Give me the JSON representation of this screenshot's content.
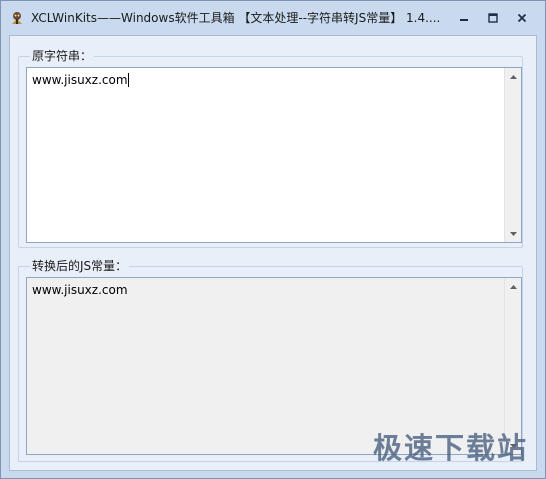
{
  "window": {
    "title": "XCLWinKits——Windows软件工具箱 【文本处理--字符串转JS常量】 1.4...."
  },
  "input_group": {
    "label": "原字符串：",
    "value": "www.jisuxz.com"
  },
  "output_group": {
    "label": "转换后的JS常量：",
    "value": "www.jisuxz.com"
  },
  "watermark": {
    "text": "极速下载站"
  },
  "icons": {
    "app": "app-icon",
    "minimize": "minimize-icon",
    "maximize": "maximize-icon",
    "close": "close-icon",
    "scroll_up": "arrow-up-icon",
    "scroll_down": "arrow-down-icon"
  },
  "colors": {
    "frame": "#c9daef",
    "client": "#e9eff8",
    "input_bg": "#ffffff",
    "output_bg": "#f0f0f0"
  }
}
